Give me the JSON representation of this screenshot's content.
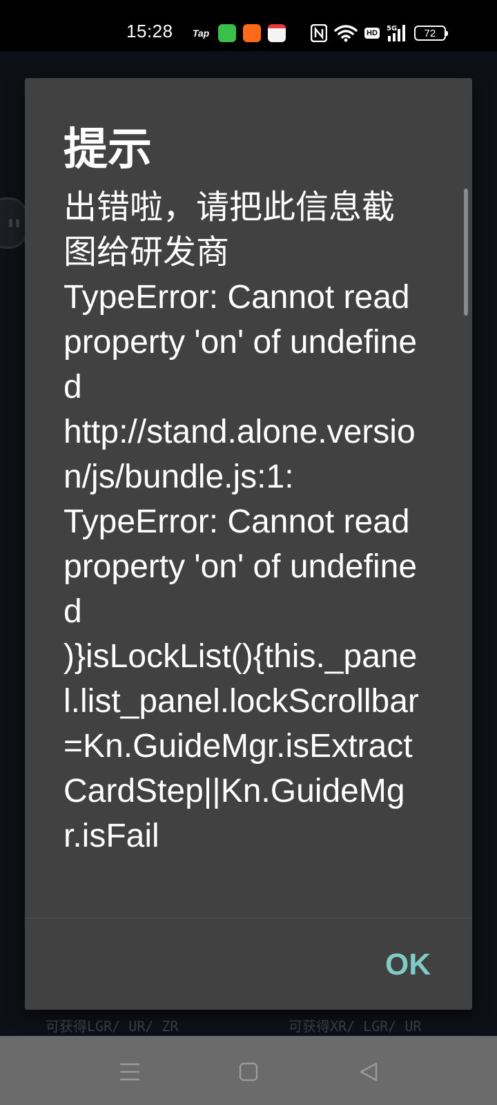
{
  "status_bar": {
    "time": "15:28",
    "apps": [
      "tap-icon",
      "green-app-icon",
      "orange-app-icon",
      "100-app-icon"
    ],
    "tap_label": "Tap",
    "hd_label": "HD",
    "network_label": "5G",
    "battery": "72"
  },
  "dialog": {
    "title": "提示",
    "message": "出错啦，请把此信息截图给研发商\nTypeError: Cannot read property 'on' of undefined\nhttp://stand.alone.version/js/bundle.js:1:\nTypeError: Cannot read property 'on' of undefined\n)}isLockList(){this._panel.list_panel.lockScrollbar=Kn.GuideMgr.isExtractCardStep||Kn.GuideMgr.isFail",
    "ok_label": "OK",
    "ok_color": "#80cbc4"
  },
  "background": {
    "left_reward_text": "可获得LGR/ UR/ ZR",
    "right_reward_text": "可获得XR/ LGR/ UR"
  },
  "nav_bar": {
    "buttons": [
      "menu-icon",
      "home-icon",
      "back-icon"
    ]
  }
}
